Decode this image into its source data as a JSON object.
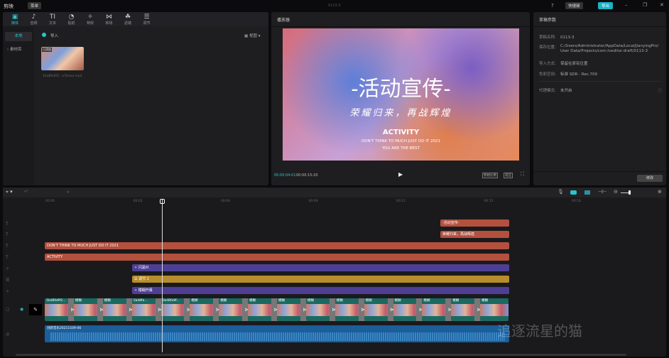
{
  "app": {
    "name": "剪映",
    "menu": "菜单",
    "project_title": "0113-3",
    "shortcut": "快捷键",
    "export": "导出"
  },
  "tabs": [
    {
      "label": "媒体",
      "icon": "media-icon",
      "glyph": "▣"
    },
    {
      "label": "音频",
      "icon": "audio-icon",
      "glyph": "♪"
    },
    {
      "label": "文本",
      "icon": "text-icon",
      "glyph": "TI"
    },
    {
      "label": "贴纸",
      "icon": "sticker-icon",
      "glyph": "◔"
    },
    {
      "label": "特效",
      "icon": "effects-icon",
      "glyph": "✧"
    },
    {
      "label": "转场",
      "icon": "transition-icon",
      "glyph": "⋈"
    },
    {
      "label": "滤镜",
      "icon": "filter-icon",
      "glyph": "☘"
    },
    {
      "label": "调节",
      "icon": "adjust-icon",
      "glyph": "☰"
    }
  ],
  "media": {
    "side": [
      "本地",
      "素材库"
    ],
    "import": "导入",
    "view": "视图",
    "thumb_badge": "已添加",
    "file_name": "1bd8fa9f2...e7baea.mp4"
  },
  "player": {
    "title": "播放器",
    "current": "00:00:04:01",
    "total": "00:00:15:20",
    "ratio": "原始比例",
    "fit": "适应",
    "frame": {
      "title": "-活动宣传-",
      "subtitle": "荣耀归来，再战辉煌",
      "english": "ACTIVITY",
      "line1": "DON'T THINK TO MUCH JUST DO IT 2021",
      "line2": "YOU ARE THE BEST"
    }
  },
  "draft": {
    "title": "草稿参数",
    "rows": [
      {
        "k": "草稿名称:",
        "v": "0113-3"
      },
      {
        "k": "保存位置:",
        "v": "C:/Users/Administrator/AppData/Local/JianyingPro/User Data/Projects/com.lveditor.draft/0113-3"
      },
      {
        "k": "导入方式:",
        "v": "保留在原有位置"
      },
      {
        "k": "色彩空间:",
        "v": "标准 SDR - Rec.709"
      },
      {
        "k": "代理模式:",
        "v": "未开启"
      }
    ],
    "modify": "修改"
  },
  "timeline": {
    "ticks": [
      "00:00",
      "00:03",
      "00:06",
      "00:09",
      "00:12",
      "00:15",
      "00:18"
    ],
    "text_clips": [
      "-活动宣传-",
      "荣耀归来，再战辉煌",
      "DON'T THINK TO MUCH JUST DO IT 2021",
      "ACTIVITY"
    ],
    "effects": [
      "闪黑III",
      "调节 1",
      "模糊开幕"
    ],
    "video_clips": [
      "1bd8fa9f2...",
      "模糊",
      "模糊",
      "1bd8fa...",
      "1bd8fa9f...",
      "模糊",
      "模糊",
      "模糊",
      "模糊",
      "模糊",
      "模糊",
      "模糊",
      "模糊",
      "模糊",
      "模糊",
      "模糊"
    ],
    "audio": "创新音乐20211109-06"
  },
  "colors": {
    "accent": "#29c5d0",
    "text_clip": "#b3503e",
    "effect_clip": "#4e3f95",
    "adjust_clip": "#b88d2c",
    "video_track": "#1a6a62",
    "audio_track": "#1b5e9a"
  }
}
